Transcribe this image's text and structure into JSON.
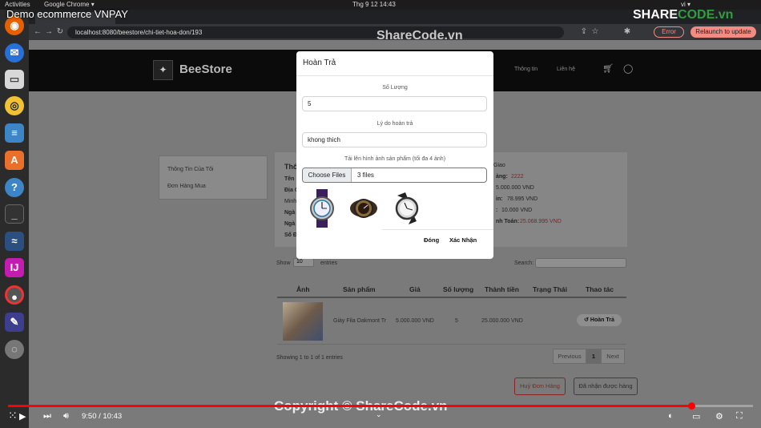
{
  "os_bar": {
    "activities": "Activities",
    "app": "Google Chrome ▾",
    "clock": "Thg 9 12  14:43",
    "lang": "vi ▾"
  },
  "video": {
    "title": "Demo ecommerce VNPAY",
    "time": "9:50 / 10:43",
    "progress_fraction": 0.917
  },
  "watermarks": {
    "top": "ShareCode.vn",
    "bottom": "Copyright © ShareCode.vn",
    "brand_a": "SHARE",
    "brand_b": "CODE.vn"
  },
  "browser": {
    "url": "localhost:8080/beestore/chi-tiet-hoa-don/193",
    "error_label": "Error",
    "relaunch_label": "Relaunch to update"
  },
  "site": {
    "brand": "BeeStore",
    "nav": [
      "Thông tin",
      "Liên hệ"
    ],
    "nav_partial": "u"
  },
  "sidebar": [
    "Thông Tin Của Tôi",
    "Đơn Hàng Mua"
  ],
  "order_info": {
    "heading_partial": "Thô",
    "left_labels": [
      "Tên",
      "Địa C",
      "Minh",
      "Ngà",
      "Ngà",
      "Số Đ"
    ],
    "right": [
      {
        "label": "Giao",
        "value": ""
      },
      {
        "label": "àng:",
        "value": "2222"
      },
      {
        "label": "",
        "value": "5.000.000 VND"
      },
      {
        "label": "in:",
        "value": "78.995 VND"
      },
      {
        "label": ":",
        "value": "10.000 VND"
      },
      {
        "label": "nh Toán:",
        "value": "25.068.995 VND"
      }
    ]
  },
  "table_controls": {
    "show": "Show",
    "entries": "entries",
    "length": "10",
    "search_label": "Search:"
  },
  "table": {
    "columns": [
      "Ảnh",
      "Sản phẩm",
      "Giá",
      "Số lượng",
      "Thành tiền",
      "Trạng Thái",
      "Thao tác"
    ],
    "rows": [
      {
        "product": "Giày Fila Oakmont Tr",
        "price": "5.000.000 VND",
        "qty": "5",
        "total": "25.000.000 VND",
        "status": "",
        "action": "↺ Hoàn Trả"
      }
    ],
    "info": "Showing 1 to 1 of 1 entries",
    "pager": {
      "prev": "Previous",
      "current": "1",
      "next": "Next"
    }
  },
  "order_buttons": {
    "cancel": "Huỷ Đơn Hàng",
    "received": "Đã nhận được hàng"
  },
  "modal": {
    "title": "Hoàn Trả",
    "qty_label": "Số Lượng",
    "qty_value": "5",
    "reason_label": "Lý do hoàn trả",
    "reason_value": "khong thich",
    "upload_label": "Tải lên hình ảnh sản phẩm (tối đa 4 ảnh)",
    "choose_files": "Choose Files",
    "files_selected": "3 files",
    "close": "Đóng",
    "confirm": "Xác Nhận"
  }
}
